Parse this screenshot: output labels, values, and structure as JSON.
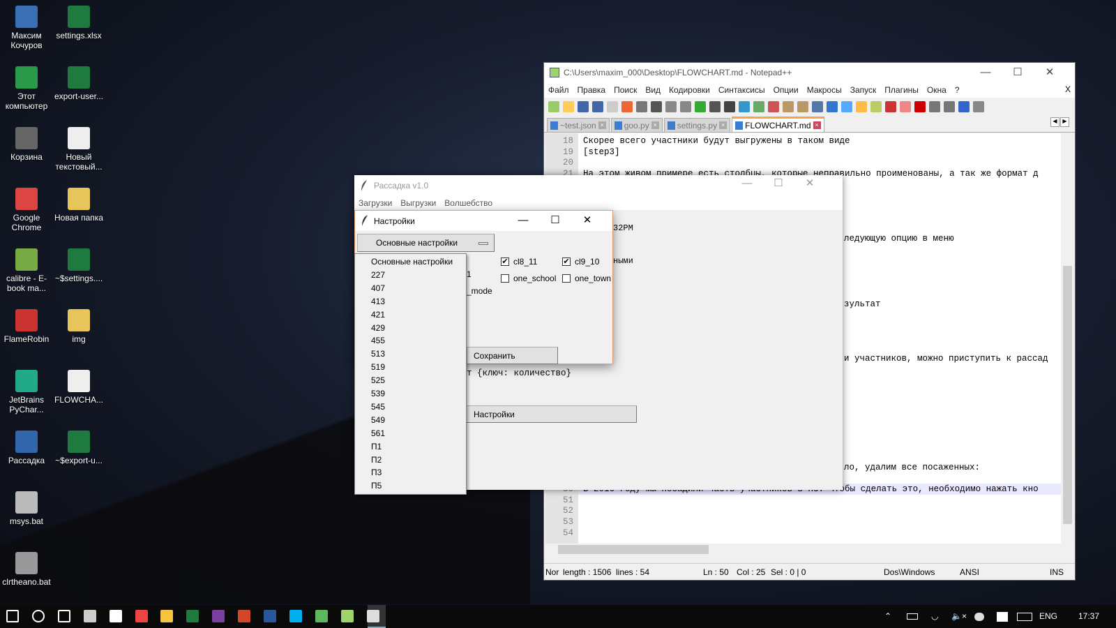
{
  "desktop": {
    "icons_col1": [
      "Максим Кочуров",
      "Этот компьютер",
      "Корзина",
      "Google Chrome",
      "calibre - E-book ma...",
      "FlameRobin",
      "JetBrains PyChar...",
      "Рассадка",
      "msys.bat",
      "clrtheano.bat"
    ],
    "icons_col2": [
      "settings.xlsx",
      "export-user...",
      "Новый текстовый...",
      "Новая папка",
      "~$settings....",
      "img",
      "FLOWCHA...",
      "~$export-u..."
    ]
  },
  "notepad": {
    "title": "C:\\Users\\maxim_000\\Desktop\\FLOWCHART.md - Notepad++",
    "menu": [
      "Файл",
      "Правка",
      "Поиск",
      "Вид",
      "Кодировки",
      "Синтаксисы",
      "Опции",
      "Макросы",
      "Запуск",
      "Плагины",
      "Окна",
      "?"
    ],
    "menu_close": "X",
    "tabs": [
      "~test.json",
      "goo.py",
      "settings.py",
      "FLOWCHART.md"
    ],
    "active_tab": "FLOWCHART.md",
    "lines": [
      {
        "n": "18",
        "text": "Скорее всего участники будут выгружены в таком виде"
      },
      {
        "n": "19",
        "text": "[step3]"
      },
      {
        "n": "20",
        "text": ""
      },
      {
        "n": "21",
        "text": "На этом живом примере есть столбцы, которые неправильно проименованы, а так же формат д"
      }
    ],
    "fragments": [
      {
        "line": 27,
        "text": "ледующую опцию в меню"
      },
      {
        "line": 33,
        "text": "зультат"
      },
      {
        "line": 38,
        "text": "и участников, можно приступить к рассад"
      },
      {
        "line": 48,
        "text": "ло, удалим все посаженных:"
      }
    ],
    "bottom_lines": [
      {
        "n": "50",
        "text": "В 2016 году мы посадили часть участников в П3. Чтобы сделать это, необходимо нажать кно"
      },
      {
        "n": "51",
        "text": ""
      },
      {
        "n": "52",
        "text": ""
      },
      {
        "n": "53",
        "text": ""
      },
      {
        "n": "54",
        "text": ""
      }
    ],
    "status": {
      "type": "Nor",
      "length": "length : 1506",
      "lines": "lines : 54",
      "ln": "Ln : 50",
      "col": "Col : 25",
      "sel": "Sel : 0 | 0",
      "eol": "Dos\\Windows",
      "encoding": "ANSI",
      "mode": "INS"
    }
  },
  "rassadka": {
    "title": "Рассадка v1.0",
    "menu": [
      "Загрузки",
      "Выгрузки",
      "Волшебство"
    ],
    "fragments": {
      "time": "32PM",
      "words": "ными",
      "format": "т {ключ: количество}"
    },
    "settings_button": "Настройки"
  },
  "settings_dialog": {
    "title": "Настройки",
    "selected": "Основные настройки",
    "checkboxes": [
      {
        "label": "cl8_11",
        "checked": true
      },
      {
        "label": "cl9_10",
        "checked": true
      },
      {
        "label": "one_school",
        "checked": false
      },
      {
        "label": "one_town",
        "checked": false
      }
    ],
    "fragment_1": "1",
    "fragment_mode": "_mode",
    "save_button": "Сохранить",
    "options": [
      "Основные настройки",
      "227",
      "407",
      "413",
      "421",
      "429",
      "455",
      "513",
      "519",
      "525",
      "539",
      "545",
      "549",
      "561",
      "П1",
      "П2",
      "П3",
      "П5"
    ]
  },
  "taskbar": {
    "language": "ENG",
    "time": "17:37",
    "apps": [
      "start",
      "search",
      "task-view",
      "calculator",
      "mail",
      "chrome",
      "explorer",
      "excel",
      "onenote",
      "powerpoint",
      "word",
      "skype",
      "utorrent",
      "notepad-plus-plus",
      "rassadka"
    ]
  },
  "colors": {
    "tab_accent": "#f9a24a",
    "dialog_border": "#e79b6a",
    "line_highlight": "#e8e8ff"
  }
}
